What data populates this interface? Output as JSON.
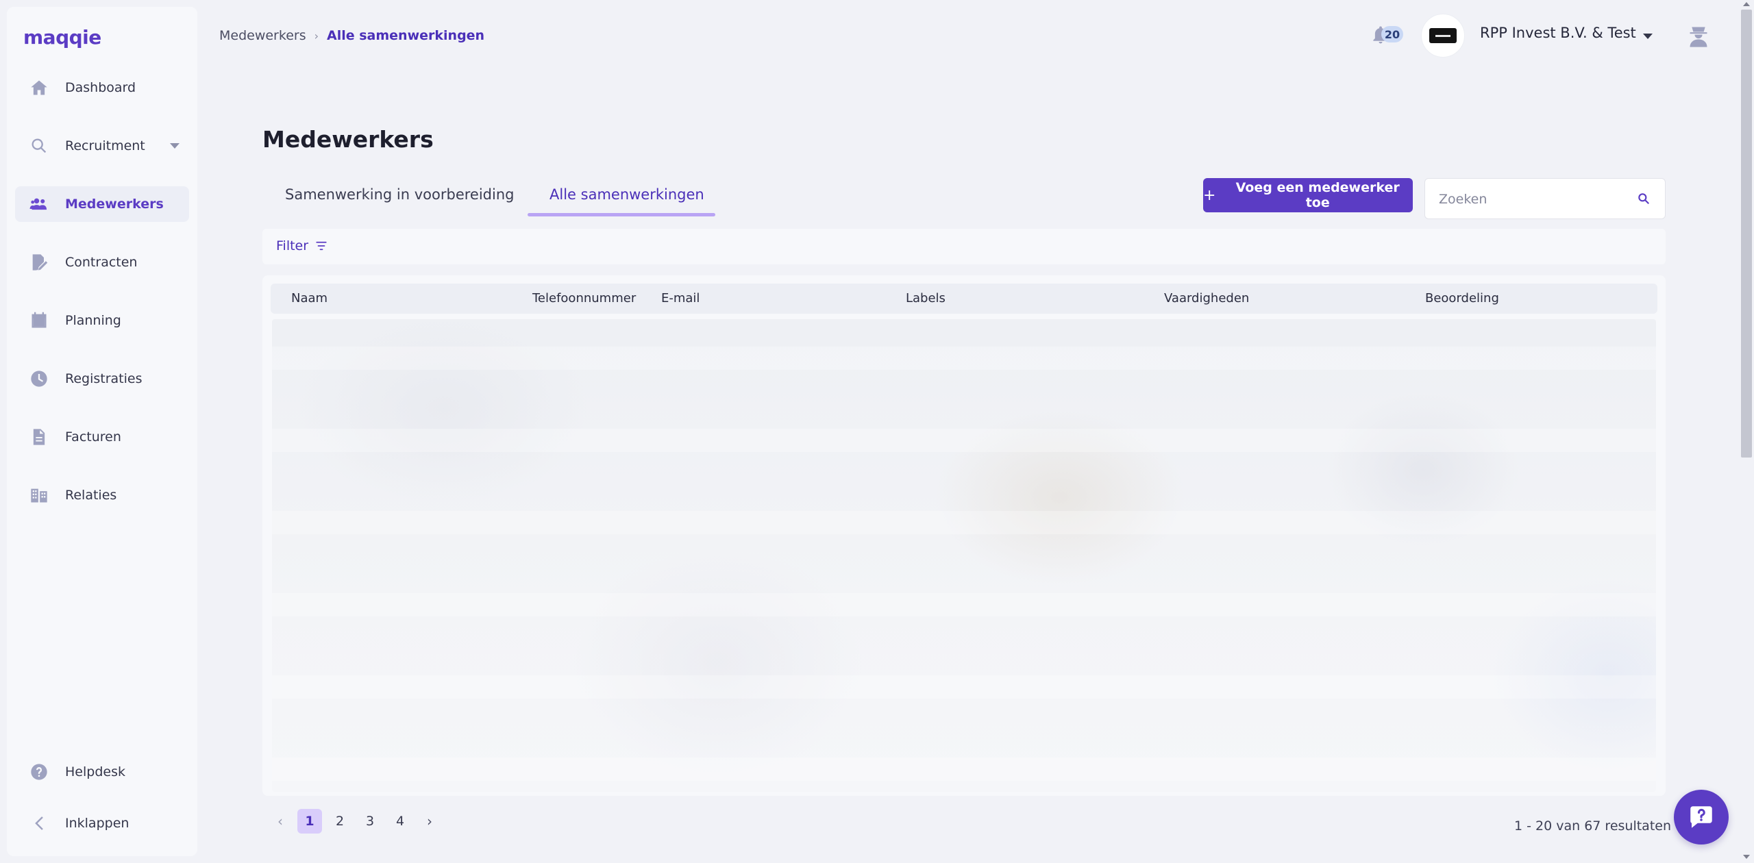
{
  "app": {
    "logo": "maqqie"
  },
  "sidebar": {
    "items": [
      {
        "label": "Dashboard",
        "icon": "home-icon"
      },
      {
        "label": "Recruitment",
        "icon": "search-icon"
      },
      {
        "label": "Medewerkers",
        "icon": "users-icon",
        "active": true
      },
      {
        "label": "Contracten",
        "icon": "contract-icon"
      },
      {
        "label": "Planning",
        "icon": "calendar-icon"
      },
      {
        "label": "Registraties",
        "icon": "clock-icon"
      },
      {
        "label": "Facturen",
        "icon": "invoice-icon"
      },
      {
        "label": "Relaties",
        "icon": "building-icon"
      }
    ],
    "footer": [
      {
        "label": "Helpdesk",
        "icon": "help-icon"
      },
      {
        "label": "Inklappen",
        "icon": "chevron-left-icon"
      }
    ]
  },
  "topbar": {
    "breadcrumb": [
      "Medewerkers",
      "Alle samenwerkingen"
    ],
    "notifications_count": "20",
    "company_name": "RPP Invest B.V. & Test"
  },
  "main": {
    "title": "Medewerkers",
    "tabs": [
      {
        "label": "Samenwerking in voorbereiding"
      },
      {
        "label": "Alle samenwerkingen",
        "active": true
      }
    ],
    "add_button": "Voeg een medewerker toe",
    "search_placeholder": "Zoeken",
    "filter_label": "Filter",
    "table": {
      "columns": [
        "Naam",
        "Telefoonnummer",
        "E-mail",
        "Labels",
        "Vaardigheden",
        "Beoordeling"
      ]
    },
    "pagination": {
      "pages": [
        "1",
        "2",
        "3",
        "4"
      ],
      "current": "1",
      "results": "1 - 20 van 67 resultaten"
    }
  },
  "colors": {
    "accent": "#5b3cc4",
    "accent_light": "#d9cdfb",
    "background": "#f1f2f7",
    "sidebar_bg": "#f7f8fb"
  }
}
